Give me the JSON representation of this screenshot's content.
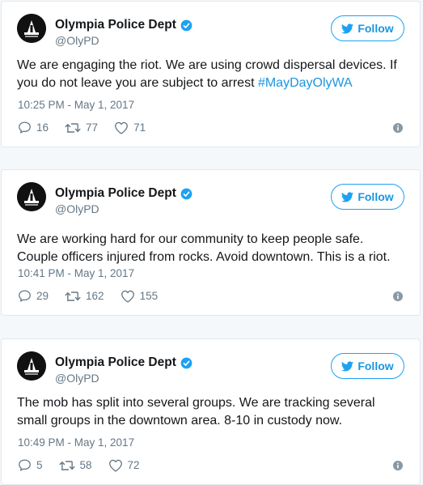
{
  "colors": {
    "link": "#1b95e0",
    "muted": "#657786",
    "text": "#14171a",
    "verified": "#1da1f2"
  },
  "tweets": [
    {
      "display_name": "Olympia Police Dept",
      "handle": "@OlyPD",
      "follow_label": "Follow",
      "avatar_caption": "Olympia Police",
      "text": "We are engaging the riot. We are using crowd dispersal devices. If you do not leave you are subject to arrest ",
      "hashtag": "#MayDayOlyWA",
      "timestamp": "10:25 PM - May 1, 2017",
      "replies": "16",
      "retweets": "77",
      "likes": "71"
    },
    {
      "display_name": "Olympia Police Dept",
      "handle": "@OlyPD",
      "follow_label": "Follow",
      "avatar_caption": "Olympia Police",
      "text": "We are working hard for our community to keep people safe. Couple officers injured from rocks. Avoid downtown. This is a riot.",
      "hashtag": "",
      "timestamp": "10:41 PM - May 1, 2017",
      "replies": "29",
      "retweets": "162",
      "likes": "155"
    },
    {
      "display_name": "Olympia Police Dept",
      "handle": "@OlyPD",
      "follow_label": "Follow",
      "avatar_caption": "Olympia Police",
      "text": "The mob has split into several groups. We are tracking several small groups in the downtown area. 8-10 in custody now.",
      "hashtag": "",
      "timestamp": "10:49 PM - May 1, 2017",
      "replies": "5",
      "retweets": "58",
      "likes": "72"
    }
  ]
}
